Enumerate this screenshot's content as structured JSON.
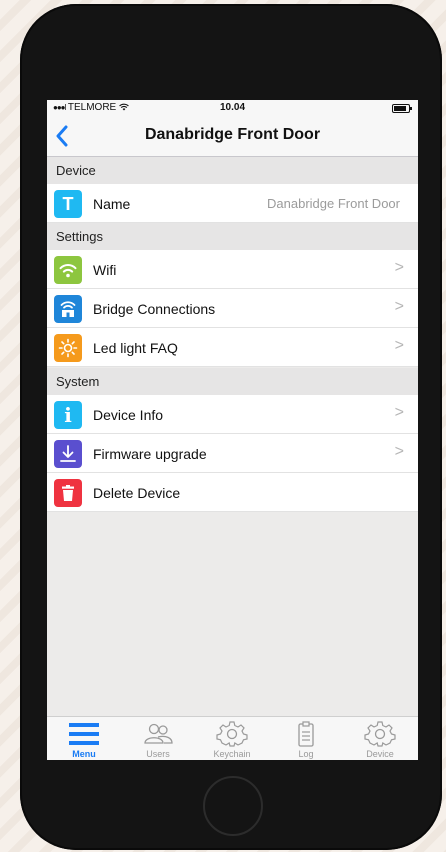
{
  "status_bar": {
    "signal": "●●●l",
    "carrier": "TELMORE",
    "time": "10.04"
  },
  "nav": {
    "back_label": "<",
    "title": "Danabridge Front Door"
  },
  "sections": [
    {
      "header": "Device",
      "rows": [
        {
          "label": "Name",
          "value": "Danabridge Front Door",
          "icon": "text-t-icon",
          "icon_glyph": "T",
          "icon_color": "#1fb9f2",
          "chevron": false
        }
      ]
    },
    {
      "header": "Settings",
      "rows": [
        {
          "label": "Wifi",
          "icon": "wifi-icon",
          "icon_color": "#8dc63f",
          "chevron": true
        },
        {
          "label": "Bridge Connections",
          "icon": "bridge-icon",
          "icon_color": "#1f86d9",
          "chevron": true
        },
        {
          "label": "Led light FAQ",
          "icon": "sun-icon",
          "icon_color": "#f59a1c",
          "chevron": true
        }
      ]
    },
    {
      "header": "System",
      "rows": [
        {
          "label": "Device Info",
          "icon": "info-icon",
          "icon_glyph": "i",
          "icon_color": "#1fb9f2",
          "chevron": true
        },
        {
          "label": "Firmware upgrade",
          "icon": "download-icon",
          "icon_color": "#5a4fcf",
          "chevron": true
        },
        {
          "label": "Delete Device",
          "icon": "trash-icon",
          "icon_color": "#ef3340",
          "chevron": false
        }
      ]
    }
  ],
  "chevron_glyph": ">",
  "tabs": [
    {
      "label": "Menu",
      "icon": "menu-icon",
      "active": true
    },
    {
      "label": "Users",
      "icon": "users-icon",
      "active": false
    },
    {
      "label": "Keychain",
      "icon": "gear-icon",
      "active": false
    },
    {
      "label": "Log",
      "icon": "clipboard-icon",
      "active": false
    },
    {
      "label": "Device",
      "icon": "gear-icon",
      "active": false
    }
  ],
  "colors": {
    "accent": "#1a7cf4",
    "inactive_tab": "#9a9a9a"
  }
}
